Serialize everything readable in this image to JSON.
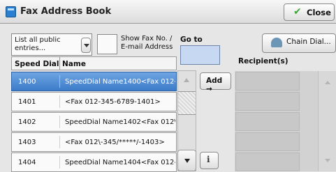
{
  "window": {
    "title": "Fax Address Book",
    "close_label": "Close",
    "title_icon": "address-book-icon",
    "close_icon": "checkmark-icon"
  },
  "filter": {
    "selected": "List all public entries...",
    "show_fax_label": "Show Fax No. / E-mail Address"
  },
  "goto": {
    "label": "Go to",
    "value": ""
  },
  "chain_dial": {
    "label": "Chain Dial...",
    "icon": "telephone-icon"
  },
  "recipients": {
    "label": "Recipient(s)"
  },
  "list": {
    "columns": [
      "Speed Dial",
      "Name"
    ],
    "rows": [
      {
        "speed_dial": "1400",
        "name": "SpeedDial Name1400<Fax 012-",
        "selected": true
      },
      {
        "speed_dial": "1401",
        "name": "<Fax 012-345-6789-1401>",
        "selected": false
      },
      {
        "speed_dial": "1402",
        "name": "SpeedDial Name1402<Fax 012\\",
        "selected": false
      },
      {
        "speed_dial": "1403",
        "name": "<Fax 012\\-345/*****/-1403>",
        "selected": false
      },
      {
        "speed_dial": "1404",
        "name": "SpeedDial Name1404<Fax 012-",
        "selected": false
      }
    ]
  },
  "buttons": {
    "add_label": "Add →",
    "info_glyph": "i"
  },
  "colors": {
    "accent": "#3c7bc9",
    "selected_row": "#4a86d4",
    "goto_field": "#c7d8f3"
  }
}
